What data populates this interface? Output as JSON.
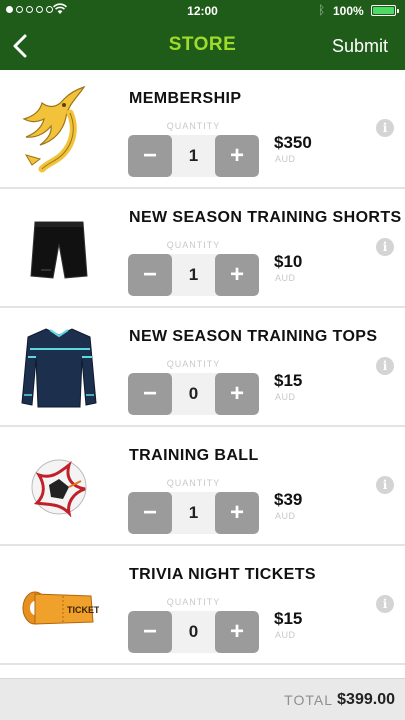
{
  "status_bar": {
    "time": "12:00",
    "battery": "100%"
  },
  "nav": {
    "title": "STORE",
    "submit_label": "Submit"
  },
  "labels": {
    "quantity": "QUANTITY",
    "currency": "AUD"
  },
  "items": [
    {
      "name": "MEMBERSHIP",
      "quantity": "1",
      "price": "$350",
      "image": "eagle-logo"
    },
    {
      "name": "NEW SEASON TRAINING SHORTS",
      "quantity": "1",
      "price": "$10",
      "image": "shorts-image"
    },
    {
      "name": "NEW SEASON TRAINING TOPS",
      "quantity": "0",
      "price": "$15",
      "image": "training-top-image"
    },
    {
      "name": "TRAINING BALL",
      "quantity": "1",
      "price": "$39",
      "image": "soccer-ball-image"
    },
    {
      "name": "TRIVIA NIGHT TICKETS",
      "quantity": "0",
      "price": "$15",
      "image": "ticket-image",
      "ticket_text": "TICKET"
    }
  ],
  "footer": {
    "total_label": "TOTAL",
    "total_value": "$399.00"
  },
  "colors": {
    "header_bg": "#1f5c1a",
    "title": "#9fdc2a",
    "stepper_button": "#9b9b9b"
  }
}
